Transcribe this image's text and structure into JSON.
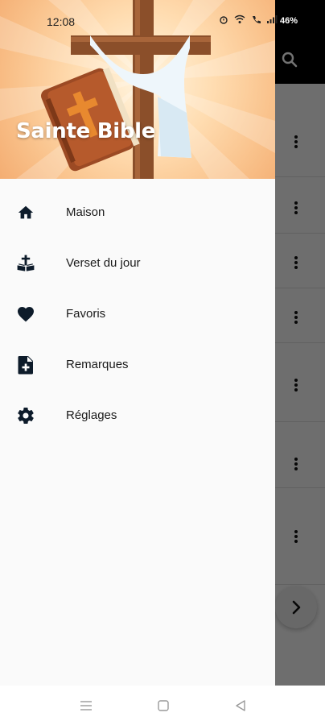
{
  "status": {
    "time": "12:08",
    "battery": "46%"
  },
  "drawer": {
    "title": "Sainte Bible",
    "items": [
      {
        "label": "Maison",
        "icon": "home-icon"
      },
      {
        "label": "Verset du jour",
        "icon": "bible-cross-icon"
      },
      {
        "label": "Favoris",
        "icon": "heart-icon"
      },
      {
        "label": "Remarques",
        "icon": "note-add-icon"
      },
      {
        "label": "Réglages",
        "icon": "gear-icon"
      }
    ]
  },
  "colors": {
    "header_light": "#fff5e0",
    "header_dark": "#f4ad72",
    "icon": "#0d1b2a",
    "scrim": "#000000"
  }
}
